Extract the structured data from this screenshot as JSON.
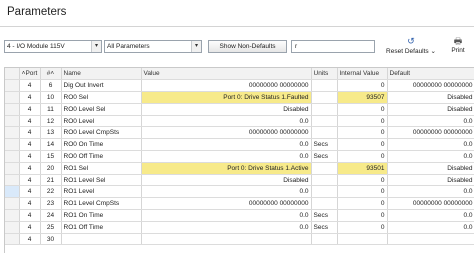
{
  "title": "Parameters",
  "toolbar": {
    "module_select": "4 - I/O Module 115V",
    "filter_select": "All Parameters",
    "non_defaults_button": "Show Non-Defaults",
    "search_value": "r",
    "reset_label": "Reset Defaults",
    "print_label": "Print",
    "dropdown_arrow": "▾",
    "reset_arrow": "⌄",
    "reset_icon": "↺",
    "print_icon": "🖶"
  },
  "table": {
    "columns": [
      "Port",
      "#",
      "Name",
      "Value",
      "Units",
      "Internal Value",
      "Default"
    ],
    "sort_markers": [
      "˄",
      "˄"
    ],
    "rows": [
      {
        "port": "4",
        "num": "6",
        "name": "Dig Out Invert",
        "value": "00000000 00000000",
        "units": "",
        "internal": "0",
        "default": "00000000 00000000",
        "highlight": false
      },
      {
        "port": "4",
        "num": "10",
        "name": "RO0 Sel",
        "value": "Port 0: Drive Status 1.Faulted",
        "units": "",
        "internal": "93507",
        "default": "Disabled",
        "highlight": true
      },
      {
        "port": "4",
        "num": "11",
        "name": "RO0 Level Sel",
        "value": "Disabled",
        "units": "",
        "internal": "0",
        "default": "Disabled",
        "highlight": false
      },
      {
        "port": "4",
        "num": "12",
        "name": "RO0 Level",
        "value": "0.0",
        "units": "",
        "internal": "0",
        "default": "0.0",
        "highlight": false
      },
      {
        "port": "4",
        "num": "13",
        "name": "RO0 Level CmpSts",
        "value": "00000000 00000000",
        "units": "",
        "internal": "0",
        "default": "00000000 00000000",
        "highlight": false
      },
      {
        "port": "4",
        "num": "14",
        "name": "RO0 On Time",
        "value": "0.0",
        "units": "Secs",
        "internal": "0",
        "default": "0.0",
        "highlight": false
      },
      {
        "port": "4",
        "num": "15",
        "name": "RO0 Off Time",
        "value": "0.0",
        "units": "Secs",
        "internal": "0",
        "default": "0.0",
        "highlight": false
      },
      {
        "port": "4",
        "num": "20",
        "name": "RO1 Sel",
        "value": "Port 0: Drive Status 1.Active",
        "units": "",
        "internal": "93501",
        "default": "Disabled",
        "highlight": true
      },
      {
        "port": "4",
        "num": "21",
        "name": "RO1 Level Sel",
        "value": "Disabled",
        "units": "",
        "internal": "0",
        "default": "Disabled",
        "highlight": false
      },
      {
        "port": "4",
        "num": "22",
        "name": "RO1 Level",
        "value": "0.0",
        "units": "",
        "internal": "0",
        "default": "0.0",
        "highlight": false
      },
      {
        "port": "4",
        "num": "23",
        "name": "RO1 Level CmpSts",
        "value": "00000000 00000000",
        "units": "",
        "internal": "0",
        "default": "00000000 00000000",
        "highlight": false
      },
      {
        "port": "4",
        "num": "24",
        "name": "RO1 On Time",
        "value": "0.0",
        "units": "Secs",
        "internal": "0",
        "default": "0.0",
        "highlight": false
      },
      {
        "port": "4",
        "num": "25",
        "name": "RO1 Off Time",
        "value": "0.0",
        "units": "Secs",
        "internal": "0",
        "default": "0.0",
        "highlight": false
      },
      {
        "port": "4",
        "num": "30",
        "name": "",
        "value": "",
        "units": "",
        "internal": "",
        "default": "",
        "highlight": false
      }
    ],
    "active_row": 9
  },
  "colors": {
    "highlight": "#f7ea8a",
    "header_bg": "#f2f2f2",
    "active_selector": "#d9e9fa",
    "reset_icon": "#2a5caa"
  }
}
